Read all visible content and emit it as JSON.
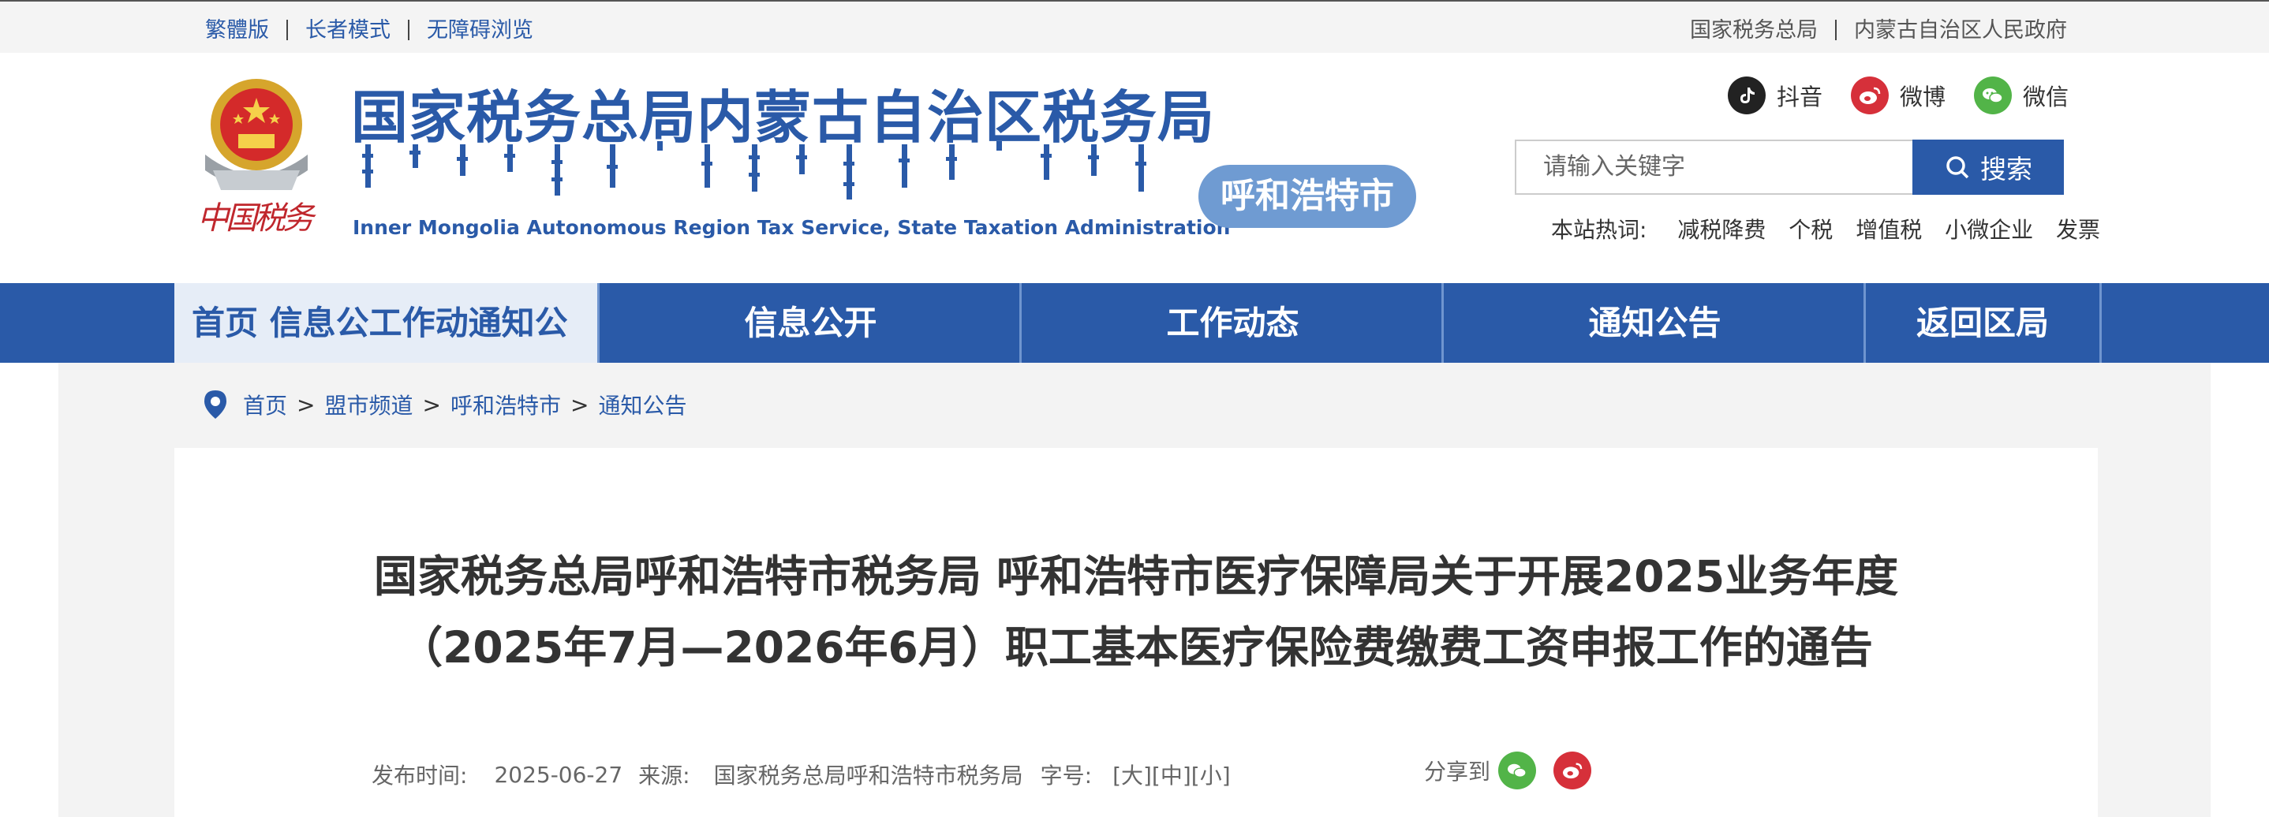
{
  "topbar": {
    "left_links": [
      "繁體版",
      "长者模式",
      "无障碍浏览"
    ],
    "right_links": [
      "国家税务总局",
      "内蒙古自治区人民政府"
    ]
  },
  "header": {
    "emblem_text": "中国税务",
    "title_cn": "国家税务总局内蒙古自治区税务局",
    "title_en": "Inner Mongolia Autonomous Region Tax Service, State Taxation Administration",
    "city_badge": "呼和浩特市",
    "social": [
      {
        "label": "抖音",
        "icon": "douyin-icon"
      },
      {
        "label": "微博",
        "icon": "weibo-icon"
      },
      {
        "label": "微信",
        "icon": "wechat-icon"
      }
    ],
    "search": {
      "placeholder": "请输入关键字",
      "button_label": "搜索"
    },
    "hot": {
      "label": "本站热词:",
      "keywords": [
        "减税降费",
        "个税",
        "增值税",
        "小微企业",
        "发票"
      ]
    }
  },
  "nav": {
    "home_text": "首页  信息公工作动通知公",
    "items": [
      "信息公开",
      "工作动态",
      "通知公告",
      "返回区局"
    ]
  },
  "breadcrumb": {
    "items": [
      "首页",
      "盟市频道",
      "呼和浩特市",
      "通知公告"
    ],
    "separator": ">"
  },
  "article": {
    "title_line1": "国家税务总局呼和浩特市税务局 呼和浩特市医疗保障局关于开展2025业务年度",
    "title_line2": "（2025年7月—2026年6月）职工基本医疗保险费缴费工资申报工作的通告",
    "meta": {
      "date_label": "发布时间:",
      "date": "2025-06-27",
      "source_label": "来源:",
      "source": "国家税务总局呼和浩特市税务局",
      "font_label": "字号:",
      "font_sizes": [
        "[大]",
        "[中]",
        "[小]"
      ]
    },
    "share_label": "分享到"
  },
  "colors": {
    "brand_blue": "#2a5aa8",
    "nav_home_bg": "#e6edf7",
    "badge_blue": "#6f9bd2",
    "wechat_green": "#52b448",
    "weibo_red": "#d6303a"
  }
}
